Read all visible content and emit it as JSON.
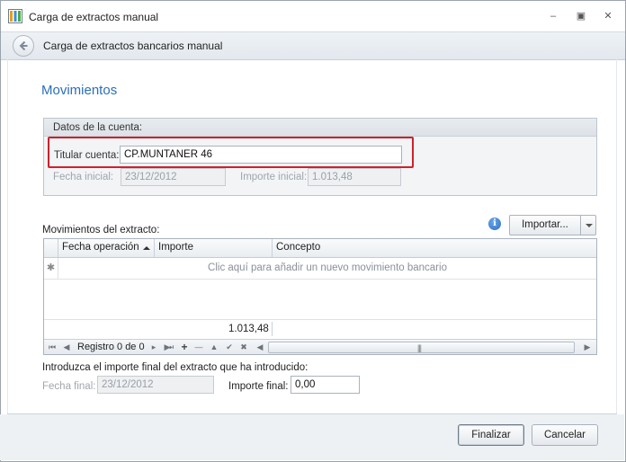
{
  "window": {
    "title": "Carga de extractos manual",
    "controls": {
      "minimize": "‒",
      "restore": "▣",
      "close": "✕"
    }
  },
  "subheader": {
    "title": "Carga de extractos bancarios manual"
  },
  "section": {
    "title": "Movimientos"
  },
  "account": {
    "group_title": "Datos de la cuenta:",
    "holder_label": "Titular cuenta:",
    "holder_value": "CP.MUNTANER 46",
    "start_date_label": "Fecha inicial:",
    "start_date_value": "23/12/2012",
    "start_amount_label": "Importe inicial:",
    "start_amount_value": "1.013,48"
  },
  "movements": {
    "label": "Movimientos del extracto:",
    "import_button": "Importar...",
    "columns": [
      "Fecha operación",
      "Importe",
      "Concepto"
    ],
    "new_row_indicator": "✱",
    "new_row_hint": "Clic aquí para añadir un nuevo movimiento bancario",
    "total": "1.013,48",
    "navigator": {
      "record_text": "Registro 0 de 0",
      "first": "⏮",
      "prev_page": "◀",
      "prev": "◂",
      "next": "▸",
      "next_page": "▶",
      "last": "⏭",
      "add": "+",
      "remove": "—",
      "up": "▲",
      "confirm": "✔",
      "cancel": "✖"
    },
    "scroll_left": "◀",
    "scroll_right": "▶",
    "scroll_grip": "|||"
  },
  "final": {
    "instruction": "Introduzca el importe final del extracto que ha introducido:",
    "end_date_label": "Fecha final:",
    "end_date_value": "23/12/2012",
    "end_amount_label": "Importe final:",
    "end_amount_value": "0,00"
  },
  "footer": {
    "finish_button": "Finalizar",
    "cancel_button": "Cancelar"
  },
  "colors": {
    "accent": "#2a6fb8",
    "highlight": "#d0202a"
  }
}
